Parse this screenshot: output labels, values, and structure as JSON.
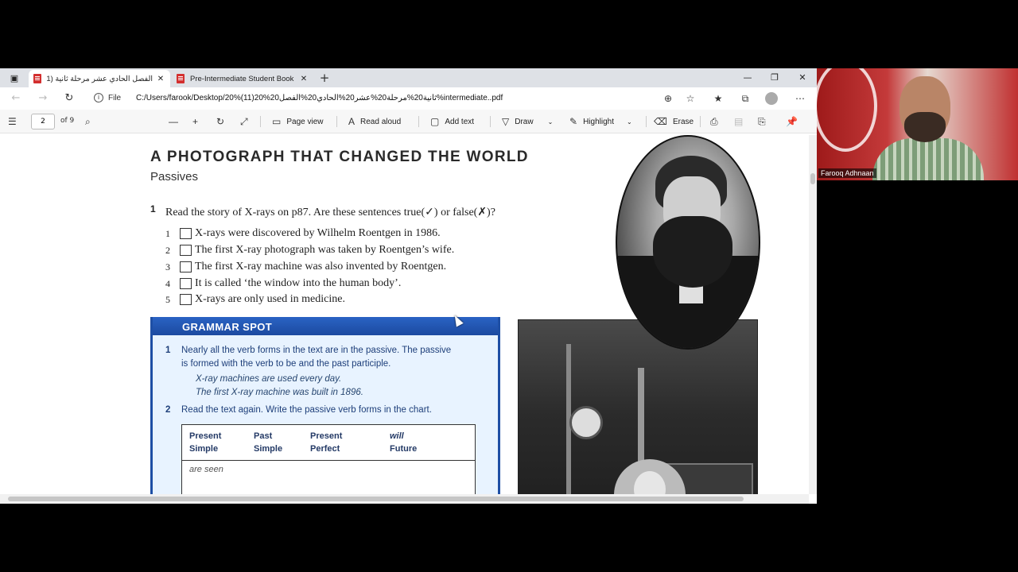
{
  "browser": {
    "tabs": [
      {
        "label": "الفصل الحادي عشر مرحلة ثانية (11)",
        "active": true
      },
      {
        "label": "Pre-Intermediate Student Book (",
        "active": false
      }
    ],
    "address": {
      "file_label": "File",
      "url": "C:/Users/farook/Desktop/20%(11)20%ثانية20%مرحلة20%عشر20%الحادي20%الفصل20%intermediate..pdf"
    }
  },
  "pdf_toolbar": {
    "page_current": "2",
    "page_total": "of 9",
    "page_view": "Page view",
    "read_aloud": "Read aloud",
    "add_text": "Add text",
    "draw": "Draw",
    "highlight": "Highlight",
    "erase": "Erase"
  },
  "document": {
    "title": "A PHOTOGRAPH THAT CHANGED THE WORLD",
    "subtitle": "Passives",
    "exercise_number": "1",
    "instruction": "Read the story of X-rays on p87. Are these sentences true(✓) or false(✗)?",
    "items": [
      {
        "num": "1",
        "text": "X-rays were discovered by Wilhelm Roentgen in 1986."
      },
      {
        "num": "2",
        "text": "The first X-ray photograph was taken by Roentgen’s wife."
      },
      {
        "num": "3",
        "text": "The first X-ray machine was also invented by Roentgen."
      },
      {
        "num": "4",
        "text": "It is called ‘the window into the human body’."
      },
      {
        "num": "5",
        "text": "X-rays are only used in medicine."
      }
    ],
    "grammar": {
      "title": "GRAMMAR SPOT",
      "p1_num": "1",
      "p1_line1": "Nearly all the verb forms in the text are in the passive. The passive",
      "p1_line2": "is formed with the verb to be and the past participle.",
      "ex1": "X-ray machines are used every day.",
      "ex2": "The first X-ray machine was built in 1896.",
      "p2_num": "2",
      "p2": "Read the text again. Write the passive verb forms in the chart.",
      "table_headers": [
        {
          "l1": "Present",
          "l2": "Simple"
        },
        {
          "l1": "Past",
          "l2": "Simple"
        },
        {
          "l1": "Present",
          "l2": "Perfect"
        },
        {
          "l1": "will",
          "l2": "Future"
        }
      ],
      "table_example": "are seen"
    }
  },
  "webcam": {
    "name": "Farooq Adhnaan"
  },
  "colors": {
    "grammar_blue": "#1e4fa5",
    "tab_strip": "#dee1e6",
    "pdf_icon_red": "#d32f2f"
  }
}
